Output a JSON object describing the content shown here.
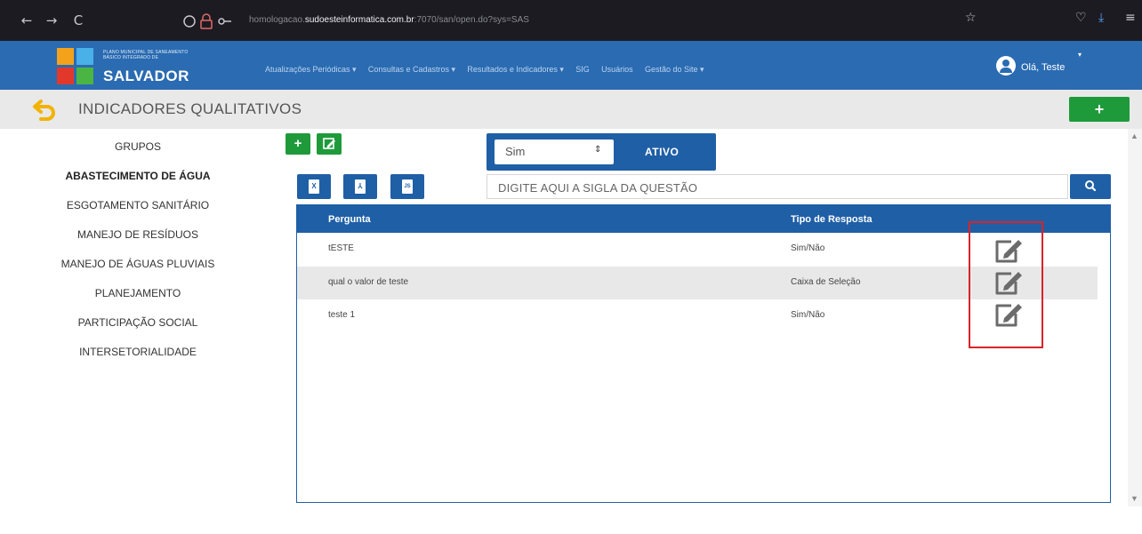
{
  "browser": {
    "back": "←",
    "forward": "→",
    "reload": "C",
    "url_prefix": "homologacao.",
    "url_domain": "sudoesteinformatica.com.br",
    "url_suffix": ":7070/san/open.do?sys=SAS",
    "star": "☆",
    "shield": "♡",
    "download": "⤓",
    "menu": "≡"
  },
  "header": {
    "logo_small": "PLANO MUNICIPAL DE SANEAMENTO BÁSICO INTEGRADO DE",
    "logo_big": "SALVADOR",
    "nav": [
      "Atualizações Periódicas ▾",
      "Consultas e Cadastros ▾",
      "Resultados e Indicadores ▾",
      "SIG",
      "Usuários",
      "Gestão do Site ▾"
    ],
    "user_label": "Olá, Teste",
    "user_caret": "▾"
  },
  "page": {
    "title": "INDICADORES QUALITATIVOS",
    "add_label": "+"
  },
  "sidebar": {
    "items": [
      "GRUPOS",
      "ABASTECIMENTO DE ÁGUA",
      "ESGOTAMENTO SANITÁRIO",
      "MANEJO DE RESÍDUOS",
      "MANEJO DE ÁGUAS PLUVIAIS",
      "PLANEJAMENTO",
      "PARTICIPAÇÃO SOCIAL",
      "INTERSETORIALIDADE"
    ],
    "active_index": 1
  },
  "toolbar": {
    "add_label": "+",
    "status_value": "Sim",
    "status_arrow": "⇕",
    "status_label": "ATIVO",
    "export": [
      {
        "name": "excel",
        "glyph": "X"
      },
      {
        "name": "pdf",
        "glyph": "⅄"
      },
      {
        "name": "json",
        "glyph": "JS"
      }
    ],
    "search_placeholder": "DIGITE AQUI A SIGLA DA QUESTÃO"
  },
  "table": {
    "headers": [
      "Pergunta",
      "Tipo de Resposta"
    ],
    "rows": [
      {
        "pergunta": "tESTE",
        "tipo": "Sim/Não"
      },
      {
        "pergunta": "qual o valor de teste",
        "tipo": "Caixa de Seleção"
      },
      {
        "pergunta": "teste 1",
        "tipo": "Sim/Não"
      }
    ]
  },
  "colors": {
    "header_blue": "#2a6bb2",
    "dark_blue": "#1f5fa6",
    "green": "#1e9a3a",
    "highlight_red": "#d8232a"
  }
}
